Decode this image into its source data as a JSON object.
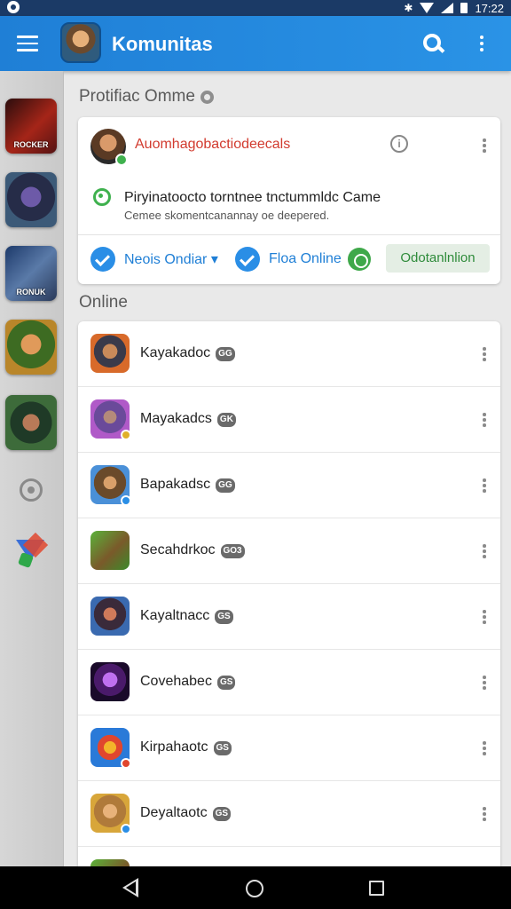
{
  "status_bar": {
    "time": "17:22",
    "icons": [
      "app-notification-icon",
      "bluetooth-icon",
      "wifi-icon",
      "signal-icon",
      "battery-icon"
    ]
  },
  "app_bar": {
    "title": "Komunitas",
    "icons": [
      "menu-icon",
      "avatar",
      "search-icon",
      "more-vert-icon"
    ],
    "color": "#1f7fd6"
  },
  "sidebar": {
    "games": [
      {
        "label": "ROCKER"
      },
      {
        "label": ""
      },
      {
        "label": "RONUK"
      },
      {
        "label": ""
      },
      {
        "label": ""
      }
    ],
    "icons": [
      "settings-icon",
      "logo-icon"
    ]
  },
  "protect_section": {
    "title": "Protifiac Omme"
  },
  "protect_card": {
    "name": "Auomhagobactiodeecals",
    "title": "Piryinatoocto torntnee tnctummldc Came",
    "subtitle": "Cemee skomentcanannay oe deepered.",
    "chips": [
      {
        "label": "Neois Ondiar ▾"
      },
      {
        "label": "Floa Online"
      }
    ],
    "action_label": "Odotanlnlion",
    "colors": {
      "name": "#d23b2f",
      "accent": "#1f7fd6",
      "success": "#3fb14e"
    }
  },
  "online_section": {
    "title": "Online",
    "rows": [
      {
        "name": "Kayakadoc",
        "tag": "GG"
      },
      {
        "name": "Mayakadcs",
        "tag": "GK"
      },
      {
        "name": "Bapakadsc",
        "tag": "GG"
      },
      {
        "name": "Secahdrkoc",
        "tag": "GO3"
      },
      {
        "name": "Kayaltnacc",
        "tag": "GS"
      },
      {
        "name": "Covehabec",
        "tag": "GS"
      },
      {
        "name": "Kirpahaotc",
        "tag": "GS"
      },
      {
        "name": "Deyaltaotc",
        "tag": "GS"
      }
    ]
  },
  "nav_bar": {
    "icons": [
      "back-icon",
      "home-icon",
      "recents-icon"
    ]
  }
}
